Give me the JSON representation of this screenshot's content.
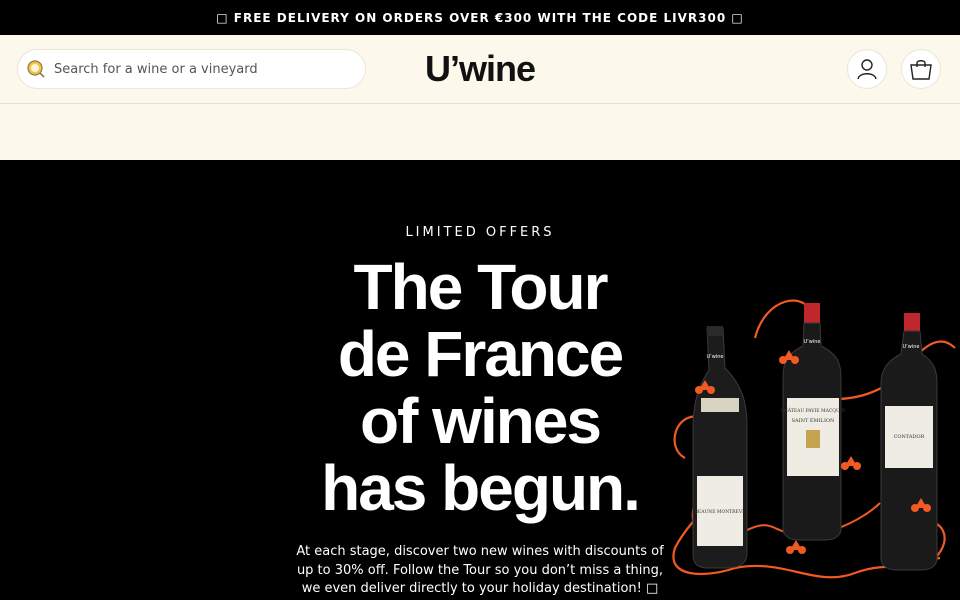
{
  "promo": {
    "text": "□ FREE DELIVERY ON ORDERS OVER €300 WITH THE CODE LIVR300 □"
  },
  "header": {
    "search_placeholder": "Search for a wine or a vineyard",
    "logo": "U’wine"
  },
  "hero": {
    "eyebrow": "LIMITED OFFERS",
    "headline_lines": [
      "The Tour",
      "de France",
      "of wines",
      "has begun."
    ],
    "body_lines": [
      "At each stage, discover two new wines with discounts of",
      "up to 30% off. Follow the Tour so you don’t miss a thing,",
      "we even deliver directly to your holiday destination! □"
    ]
  },
  "bottles": {
    "left_label": "BEAUNE MONTREVE",
    "middle_label": "CHÂTEAU PAVIE MACQUIN",
    "middle_sub": "SAINT ÉMILION",
    "right_label": "CONTADOR",
    "brand": "U’wine"
  },
  "colors": {
    "accent": "#f15a22",
    "cream": "#fdf8ec",
    "black": "#000000"
  },
  "icons": [
    "search-icon",
    "user-icon",
    "bag-icon"
  ]
}
